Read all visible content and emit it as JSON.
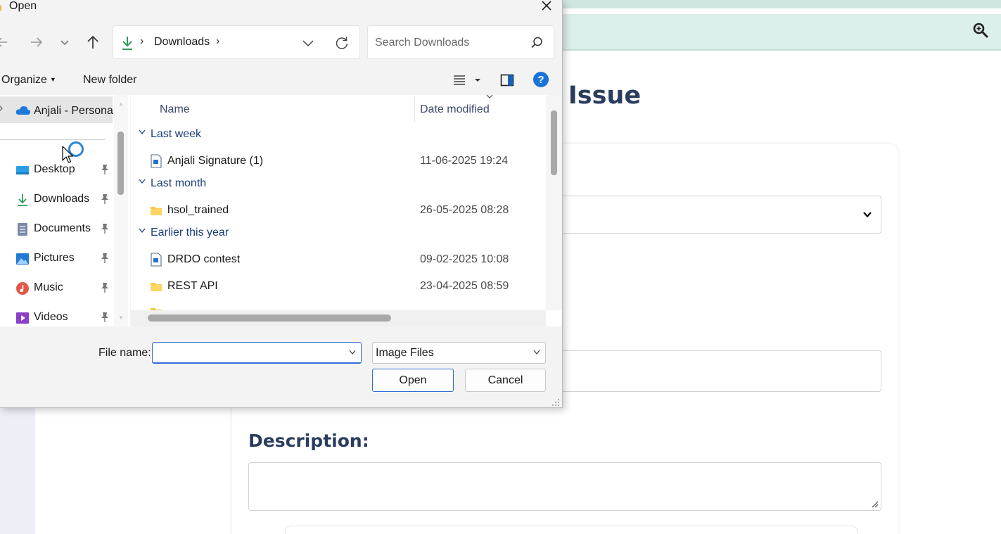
{
  "background_page": {
    "heading_fragment": "vic Issue",
    "description_label": "Description:",
    "search_icon": "magnifier-icon"
  },
  "dialog": {
    "title": "Open",
    "close_icon": "close-icon",
    "address": {
      "separator": "›",
      "current_folder": "Downloads",
      "trailing_separator": "›"
    },
    "search_placeholder": "Search Downloads",
    "toolbar": {
      "organize_label": "Organize",
      "new_folder_label": "New folder"
    },
    "nav": {
      "onedrive_label": "Anjali - Personal",
      "items": [
        {
          "label": "Desktop",
          "icon": "desktop-icon",
          "color": "#2b9ee6"
        },
        {
          "label": "Downloads",
          "icon": "download-icon",
          "color": "#2f9a5a"
        },
        {
          "label": "Documents",
          "icon": "documents-icon",
          "color": "#7a8aa8"
        },
        {
          "label": "Pictures",
          "icon": "pictures-icon",
          "color": "#2479d4"
        },
        {
          "label": "Music",
          "icon": "music-icon",
          "color": "#e05a4a"
        },
        {
          "label": "Videos",
          "icon": "videos-icon",
          "color": "#8a3fc8"
        }
      ]
    },
    "columns": {
      "name": "Name",
      "date_modified": "Date modified"
    },
    "groups": [
      {
        "label": "Last week",
        "files": [
          {
            "name": "Anjali Signature (1)",
            "date": "11-06-2025 19:24",
            "type": "image"
          }
        ]
      },
      {
        "label": "Last month",
        "files": [
          {
            "name": "hsol_trained",
            "date": "26-05-2025 08:28",
            "type": "folder"
          }
        ]
      },
      {
        "label": "Earlier this year",
        "files": [
          {
            "name": "DRDO contest",
            "date": "09-02-2025 10:08",
            "type": "image"
          },
          {
            "name": "REST API",
            "date": "23-04-2025 08:59",
            "type": "folder"
          }
        ]
      }
    ],
    "file_name_label": "File name:",
    "file_name_value": "",
    "file_type_filter": "Image Files",
    "open_label": "Open",
    "cancel_label": "Cancel",
    "accent_color": "#2f6fd6",
    "folder_color": "#f6c945"
  }
}
